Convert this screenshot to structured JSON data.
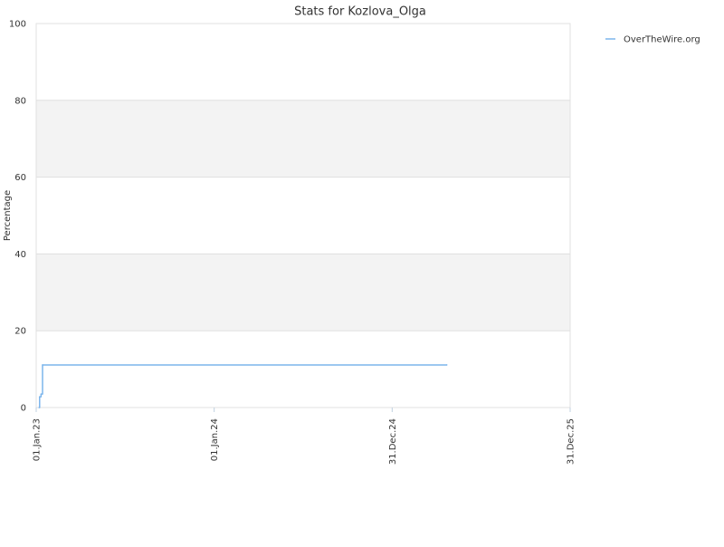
{
  "chart_data": {
    "type": "line",
    "title": "Stats for Kozlova_Olga",
    "xlabel": "",
    "ylabel": "Percentage",
    "ylim": [
      0,
      100
    ],
    "yticks": [
      0,
      20,
      40,
      60,
      80,
      100
    ],
    "xlim": [
      "2023-01-01",
      "2025-12-31"
    ],
    "xticks": [
      {
        "value": "2023-01-01",
        "label": "01.Jan.23"
      },
      {
        "value": "2024-01-01",
        "label": "01.Jan.24"
      },
      {
        "value": "2024-12-31",
        "label": "31.Dec.24"
      },
      {
        "value": "2025-12-31",
        "label": "31.Dec.25"
      }
    ],
    "grid": true,
    "legend_position": "top-right",
    "series": [
      {
        "name": "OverTheWire.org",
        "color": "#7cb5ec",
        "step": true,
        "points": [
          {
            "x": "2023-01-07",
            "y": 0
          },
          {
            "x": "2023-01-08",
            "y": 2.8
          },
          {
            "x": "2023-01-11",
            "y": 3.5
          },
          {
            "x": "2023-01-14",
            "y": 11.1
          },
          {
            "x": "2025-04-22",
            "y": 11.1
          }
        ]
      }
    ]
  }
}
